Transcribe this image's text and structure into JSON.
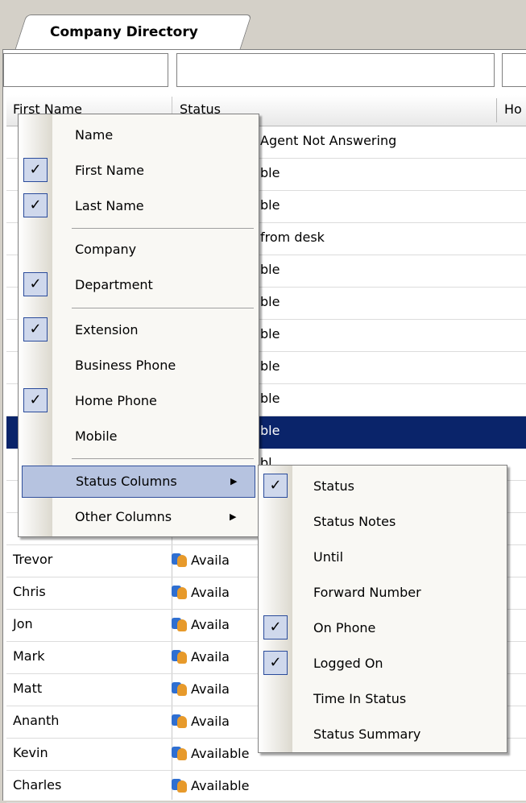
{
  "tab": {
    "label": "Company Directory"
  },
  "grid": {
    "columns": [
      "First Name",
      "Status",
      "Ho"
    ],
    "first_names": [
      "Trevor",
      "Chris",
      "Jon",
      "Mark",
      "Matt",
      "Ananth",
      "Kevin",
      "Charles"
    ],
    "status_available": "Availa",
    "status_available_full": "Available",
    "visible_status_fragments": [
      "Agent Not Answering",
      "ble",
      "ble",
      "from desk",
      "ble",
      "ble",
      "ble",
      "ble",
      "ble",
      "ble",
      "bl"
    ]
  },
  "context_menu": {
    "items": [
      {
        "label": "Name",
        "checked": false
      },
      {
        "label": "First Name",
        "checked": true
      },
      {
        "label": "Last Name",
        "checked": true
      },
      {
        "label": "Company",
        "checked": false
      },
      {
        "label": "Department",
        "checked": true
      },
      {
        "label": "Extension",
        "checked": true
      },
      {
        "label": "Business Phone",
        "checked": false
      },
      {
        "label": "Home Phone",
        "checked": true
      },
      {
        "label": "Mobile",
        "checked": false
      },
      {
        "label": "Status Columns",
        "submenu": true
      },
      {
        "label": "Other Columns",
        "submenu": true
      }
    ]
  },
  "status_submenu": {
    "items": [
      {
        "label": "Status",
        "checked": true
      },
      {
        "label": "Status Notes",
        "checked": false
      },
      {
        "label": "Until",
        "checked": false
      },
      {
        "label": "Forward Number",
        "checked": false
      },
      {
        "label": "On Phone",
        "checked": true
      },
      {
        "label": "Logged On",
        "checked": true
      },
      {
        "label": "Time In Status",
        "checked": false
      },
      {
        "label": "Status Summary",
        "checked": false
      }
    ]
  },
  "icons": {
    "check": "check-icon",
    "submenu_arrow": "arrow-right-icon",
    "agent": "agent-icon"
  },
  "colors": {
    "selection": "#0a246a",
    "menu_highlight": "#b6c3e0",
    "check_bg": "#cfd8ec"
  }
}
